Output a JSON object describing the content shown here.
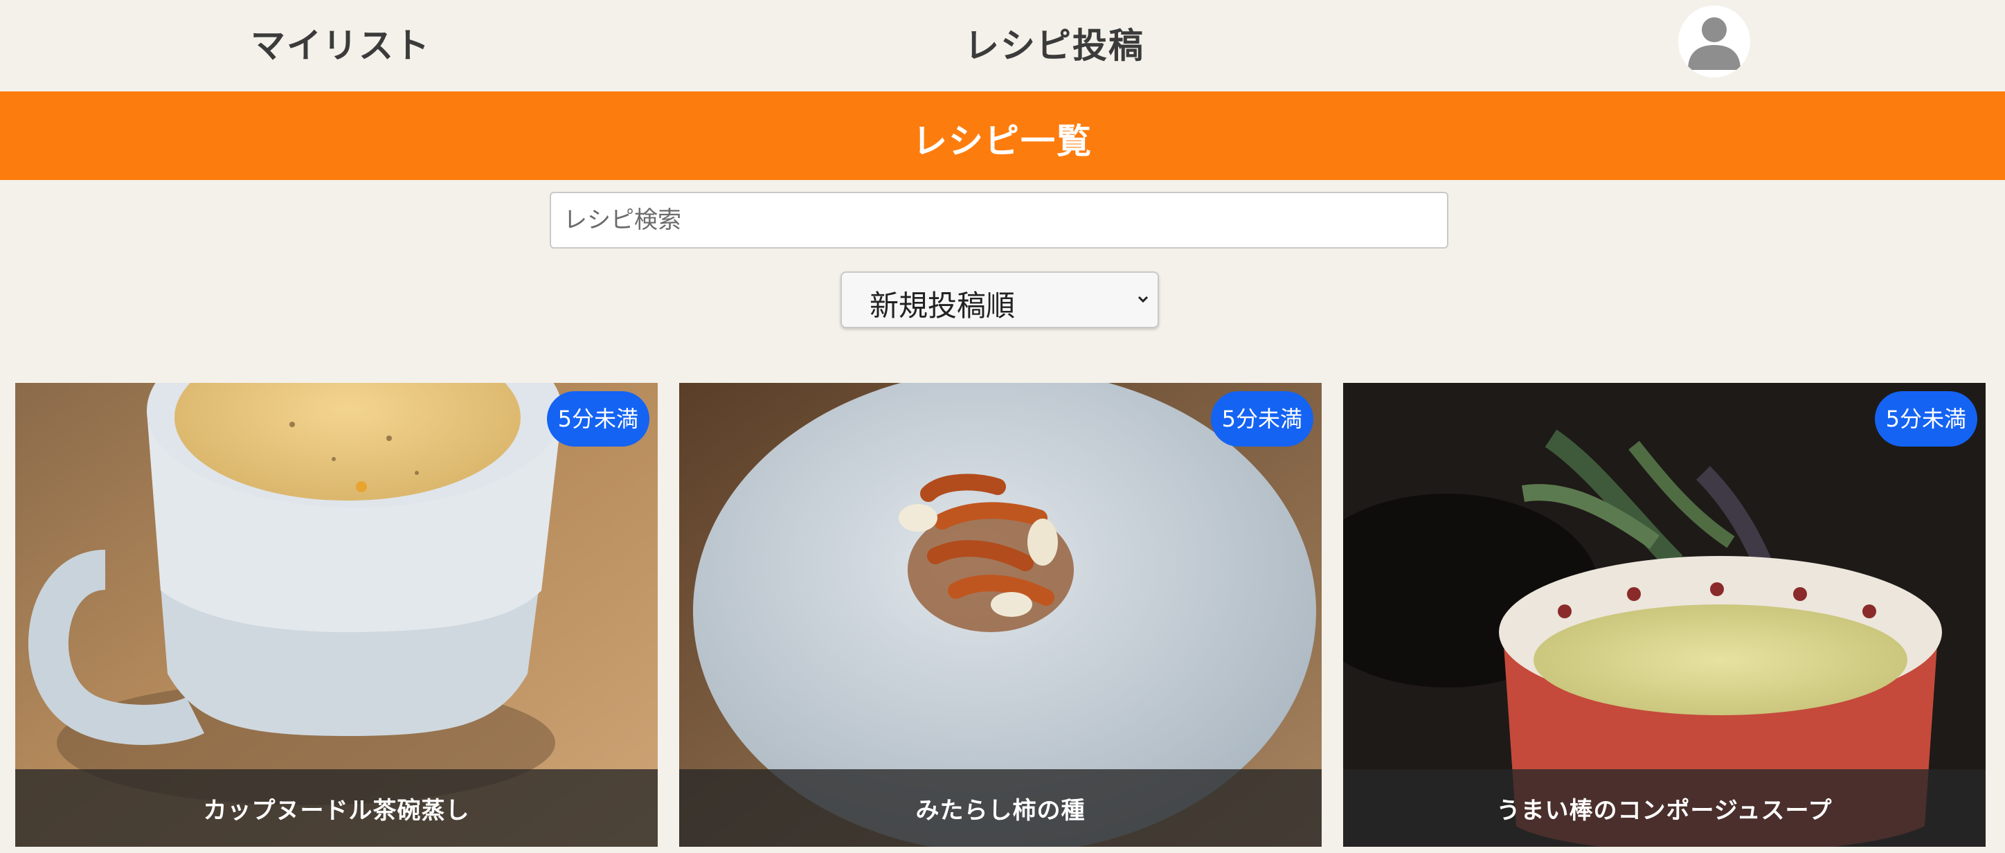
{
  "header": {
    "nav_mylist": "マイリスト",
    "nav_post": "レシピ投稿",
    "avatar_icon": "user-avatar-icon"
  },
  "banner": {
    "title": "レシピ一覧"
  },
  "search": {
    "placeholder": "レシピ検索",
    "value": ""
  },
  "sort": {
    "selected": "新規投稿順",
    "icon": "chevron-down-icon"
  },
  "recipes": [
    {
      "title": "カップヌードル茶碗蒸し",
      "badge": "5分未満"
    },
    {
      "title": "みたらし柿の種",
      "badge": "5分未満"
    },
    {
      "title": "うまい棒のコンポージュスープ",
      "badge": "5分未満"
    }
  ],
  "colors": {
    "background": "#f4f1ea",
    "banner": "#fd7c0e",
    "badge": "#1463f3",
    "caption_overlay": "#282828"
  }
}
